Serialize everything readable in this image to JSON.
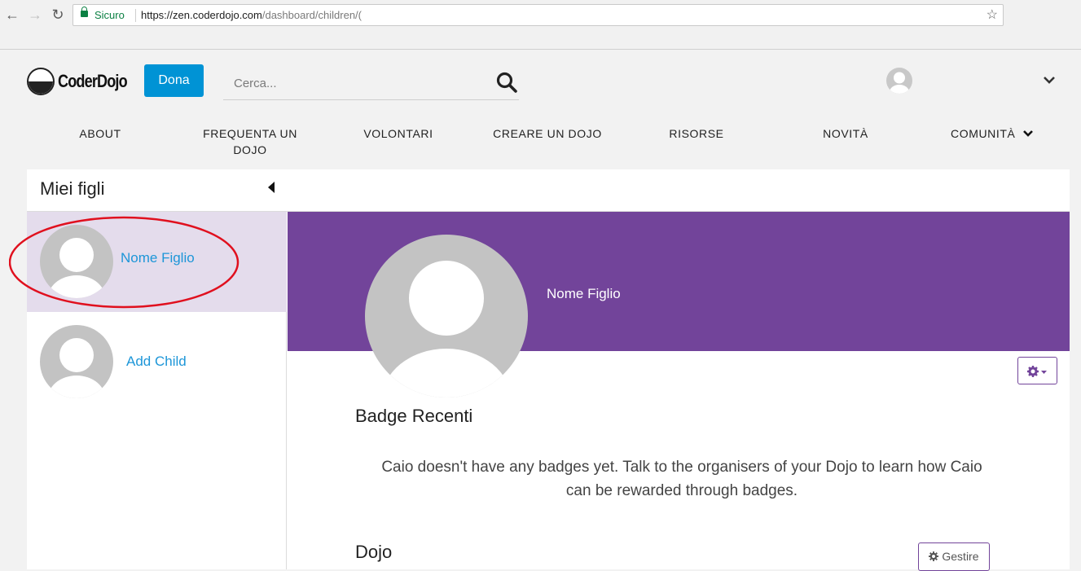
{
  "browser": {
    "secure_label": "Sicuro",
    "url_main": "https://zen.coderdojo.com",
    "url_rest": "/dashboard/children/("
  },
  "header": {
    "logo_text": "CoderDojo",
    "donate_label": "Dona",
    "search_placeholder": "Cerca..."
  },
  "nav": {
    "items": [
      "ABOUT",
      "FREQUENTA UN DOJO",
      "VOLONTARI",
      "CREARE UN DOJO",
      "RISORSE",
      "NOVITÀ",
      "COMUNITÀ"
    ]
  },
  "sidebar": {
    "title": "Miei figli",
    "children": [
      {
        "name": "Nome Figlio",
        "active": true
      },
      {
        "name": "Add Child",
        "active": false
      }
    ]
  },
  "profile": {
    "name": "Nome Figlio"
  },
  "badges": {
    "title": "Badge Recenti",
    "empty_message": "Caio doesn't have any badges yet. Talk to the organisers of your Dojo to learn how Caio can be rewarded through badges."
  },
  "dojo": {
    "title": "Dojo",
    "manage_label": "Gestire"
  },
  "colors": {
    "accent_purple": "#72449a",
    "link_blue": "#1d96d8",
    "donate_blue": "#0093d5",
    "highlight_red": "#e0101e"
  }
}
